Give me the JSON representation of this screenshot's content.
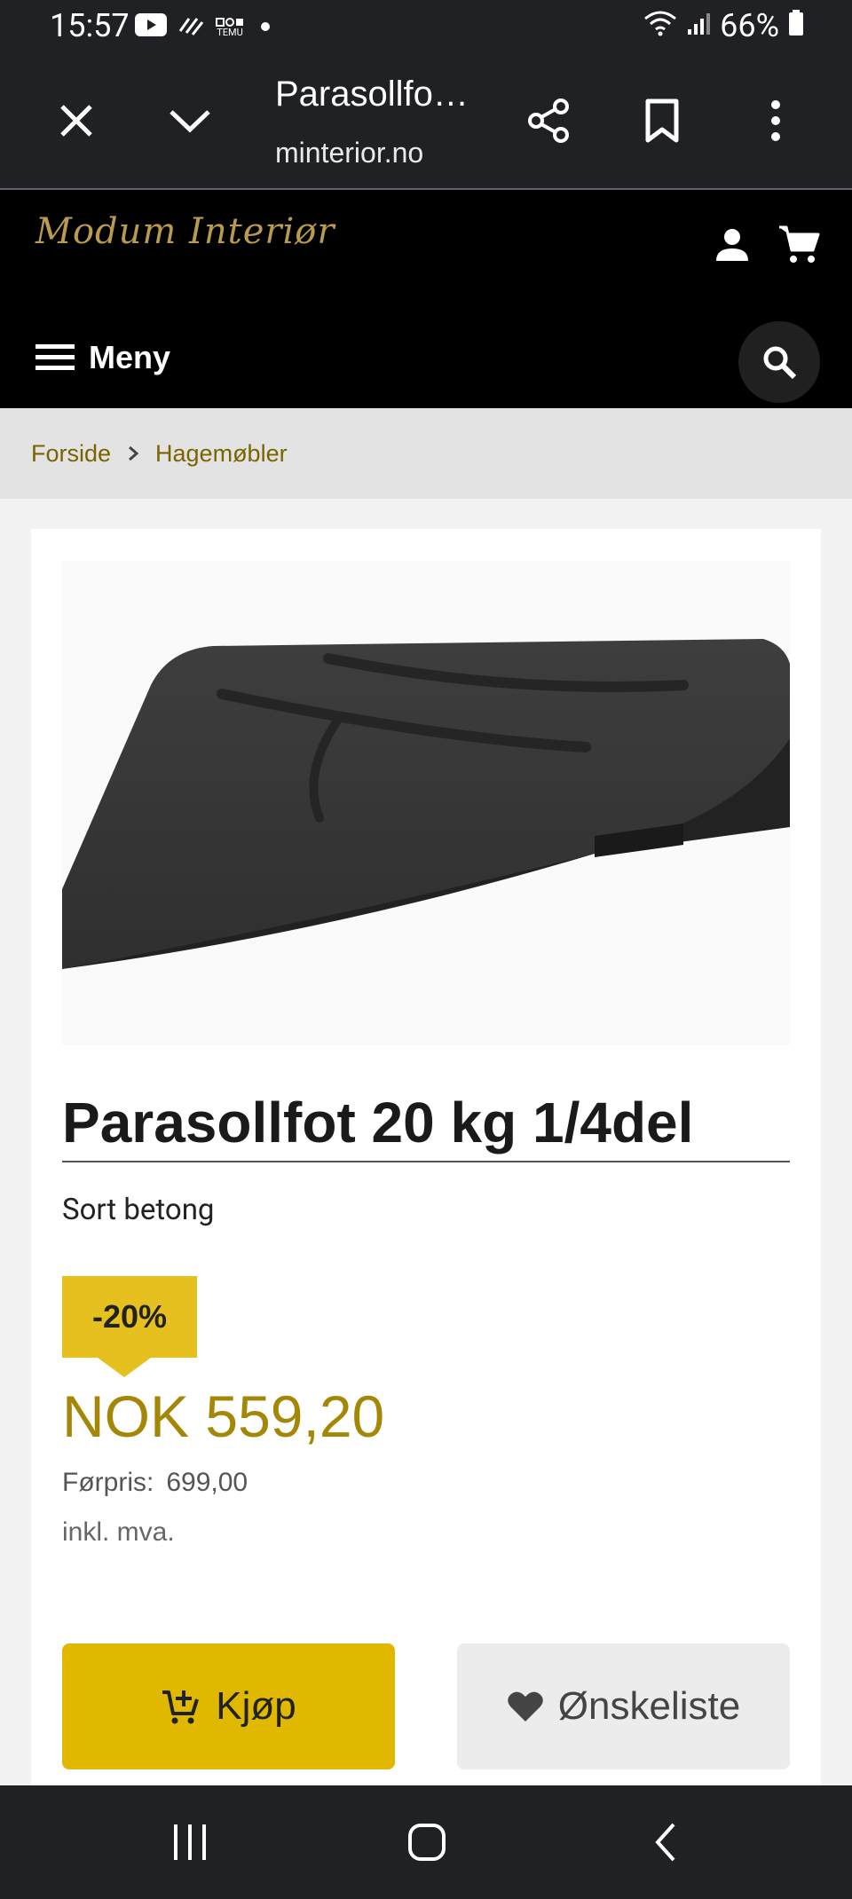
{
  "status_bar": {
    "time": "15:57",
    "battery": "66%",
    "temu_label": "TEMU"
  },
  "browser": {
    "page_title": "Parasollfo…",
    "domain": "minterior.no"
  },
  "site": {
    "logo_text": "Modum Interiør",
    "menu_label": "Meny"
  },
  "breadcrumb": {
    "items": [
      "Forside",
      "Hagemøbler"
    ]
  },
  "product": {
    "title": "Parasollfot 20 kg 1/4del",
    "subtitle": "Sort betong",
    "discount": "-20%",
    "price": "NOK 559,20",
    "before_price_label": "Førpris:",
    "before_price_value": "699,00",
    "vat_note": "inkl. mva.",
    "buy_label": "Kjøp",
    "wishlist_label": "Ønskeliste"
  },
  "colors": {
    "accent_yellow": "#e0b800",
    "price_gold": "#a48707",
    "header_black": "#000000",
    "chrome_dark": "#202124"
  },
  "icons": {
    "close": "close-icon",
    "chevron_down": "chevron-down-icon",
    "share": "share-icon",
    "bookmark": "bookmark-icon",
    "more": "more-vertical-icon",
    "user": "user-icon",
    "cart": "cart-icon",
    "menu": "hamburger-icon",
    "search": "search-icon",
    "breadcrumb_separator": "chevron-right-icon",
    "buy": "cart-plus-icon",
    "wishlist": "heart-icon"
  }
}
